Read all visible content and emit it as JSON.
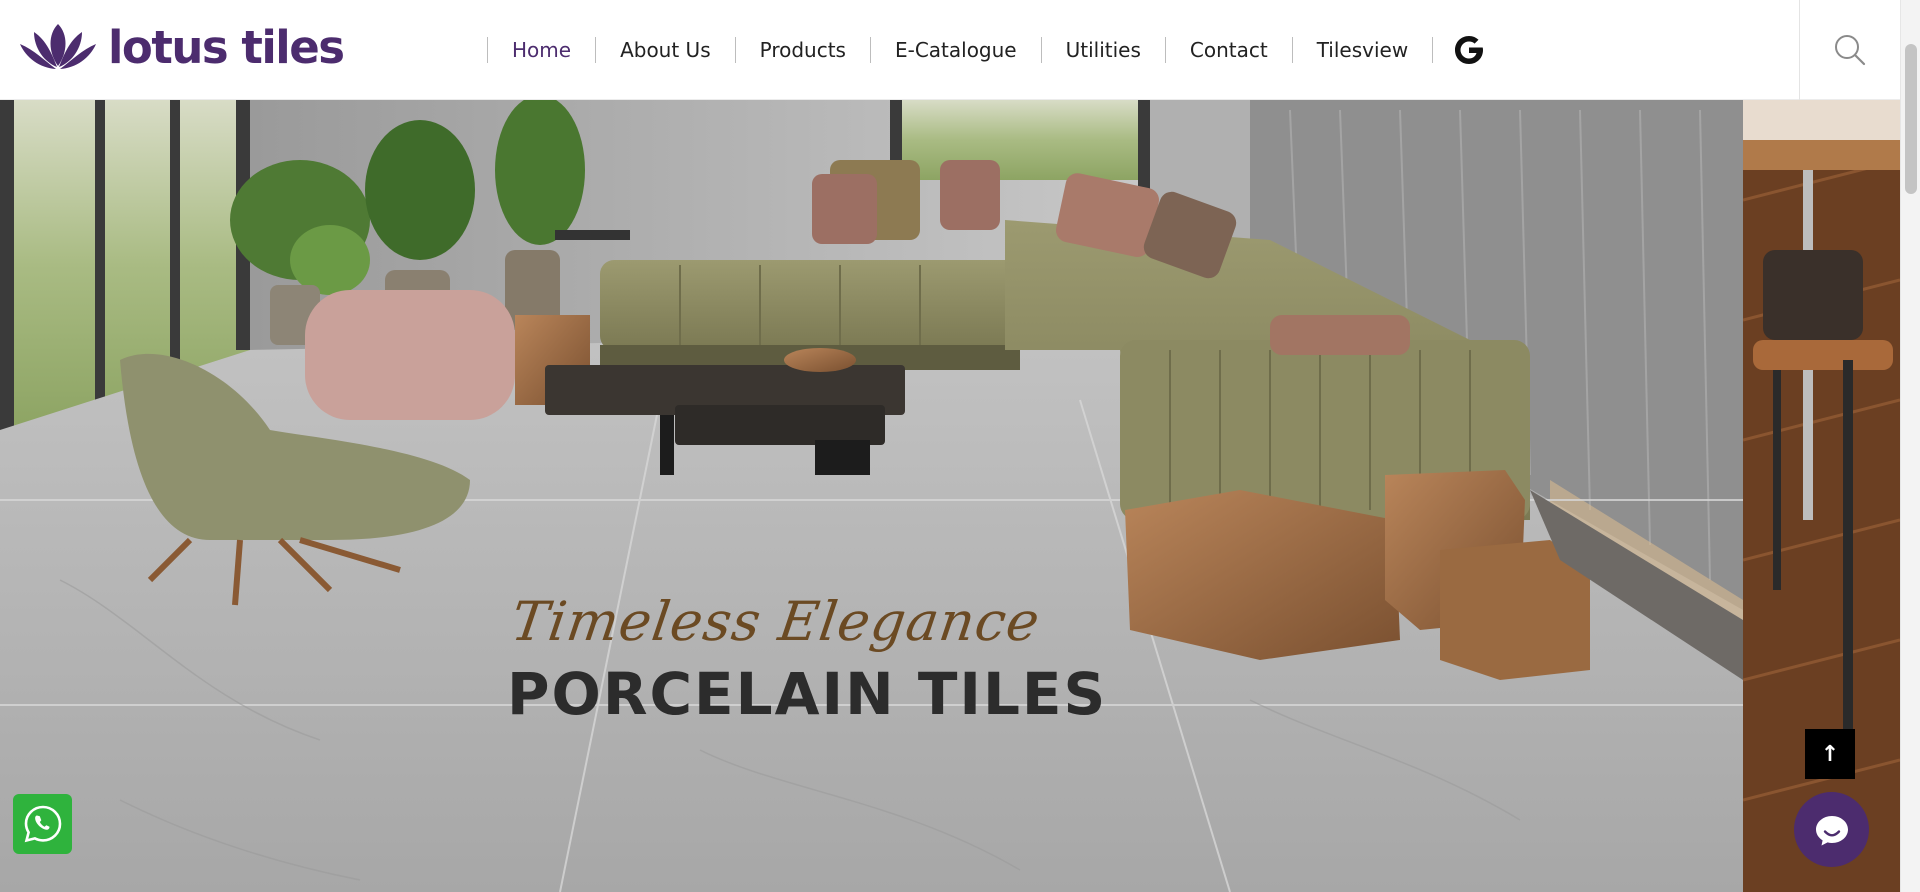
{
  "brand": {
    "name": "lotus tiles",
    "color": "#4c2c6e",
    "logo_icon": "lotus-flower-icon"
  },
  "nav": {
    "items": [
      {
        "label": "Home",
        "active": true
      },
      {
        "label": "About Us",
        "active": false
      },
      {
        "label": "Products",
        "active": false
      },
      {
        "label": "E-Catalogue",
        "active": false
      },
      {
        "label": "Utilities",
        "active": false
      },
      {
        "label": "Contact",
        "active": false
      },
      {
        "label": "Tilesview",
        "active": false
      }
    ],
    "extra_icon": "google-g-icon",
    "search_icon": "search-icon"
  },
  "hero": {
    "tagline": "Timeless Elegance",
    "title": "PORCELAIN TILES",
    "tagline_color": "#6b4a23"
  },
  "floating": {
    "whatsapp_icon": "whatsapp-icon",
    "whatsapp_color": "#2fb33d",
    "back_to_top_icon": "arrow-up-icon",
    "back_to_top_label": "↑",
    "chat_icon": "chat-bubble-icon"
  }
}
